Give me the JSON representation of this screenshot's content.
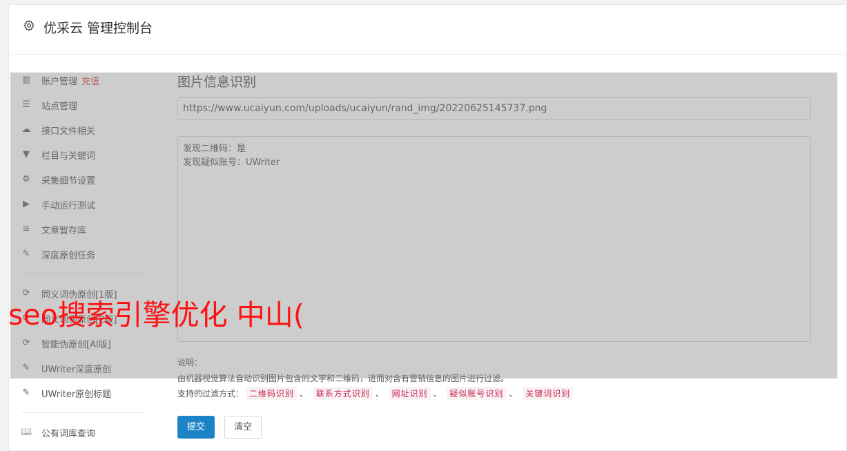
{
  "header": {
    "title": "优采云 管理控制台",
    "icon": "gear-icon"
  },
  "sidebar": {
    "items": [
      {
        "label": "账户管理",
        "badge": "充值",
        "icon": "bar-chart-icon",
        "glyph": "▥"
      },
      {
        "label": "站点管理",
        "icon": "server-icon",
        "glyph": "☰"
      },
      {
        "label": "接口文件相关",
        "icon": "cloud-upload-icon",
        "glyph": "☁"
      },
      {
        "label": "栏目与关键词",
        "icon": "filter-icon",
        "glyph": "▼"
      },
      {
        "label": "采集细节设置",
        "icon": "cogs-icon",
        "glyph": "⚙"
      },
      {
        "label": "手动运行测试",
        "icon": "play-circle-icon",
        "glyph": "▶"
      },
      {
        "label": "文章暂存库",
        "icon": "database-icon",
        "glyph": "≡"
      },
      {
        "label": "深度原创任务",
        "icon": "edit-icon",
        "glyph": "✎"
      },
      {
        "label": "同义词伪原创[1版]",
        "icon": "refresh-icon",
        "glyph": "⟳"
      },
      {
        "label": "同义词伪原创[2版]",
        "icon": "refresh-icon",
        "glyph": "⟳"
      },
      {
        "label": "智能伪原创[AI版]",
        "icon": "refresh-icon",
        "glyph": "⟳"
      },
      {
        "label": "UWriter深度原创",
        "icon": "edit-icon",
        "glyph": "✎"
      },
      {
        "label": "UWriter原创标题",
        "icon": "edit-icon",
        "glyph": "✎"
      },
      {
        "label": "公有词库查询",
        "icon": "book-icon",
        "glyph": "📖"
      }
    ]
  },
  "main": {
    "section_title": "图片信息识别",
    "url_value": "https://www.ucaiyun.com/uploads/ucaiyun/rand_img/20220625145737.png",
    "result_lines": [
      "发现二维码：是",
      "发现疑似账号：UWriter"
    ],
    "desc_label": "说明：",
    "desc_text": "由机器视觉算法自动识别图片包含的文字和二维码，进而对含有营销信息的图片进行过滤。",
    "filter_label": "支持的过滤方式：",
    "filter_tags": [
      "二维码识别",
      "联系方式识别",
      "网址识别",
      "疑似账号识别",
      "关键词识别"
    ],
    "submit_label": "提交",
    "clear_label": "清空"
  },
  "watermark": "seo搜索引擎优化 中山("
}
